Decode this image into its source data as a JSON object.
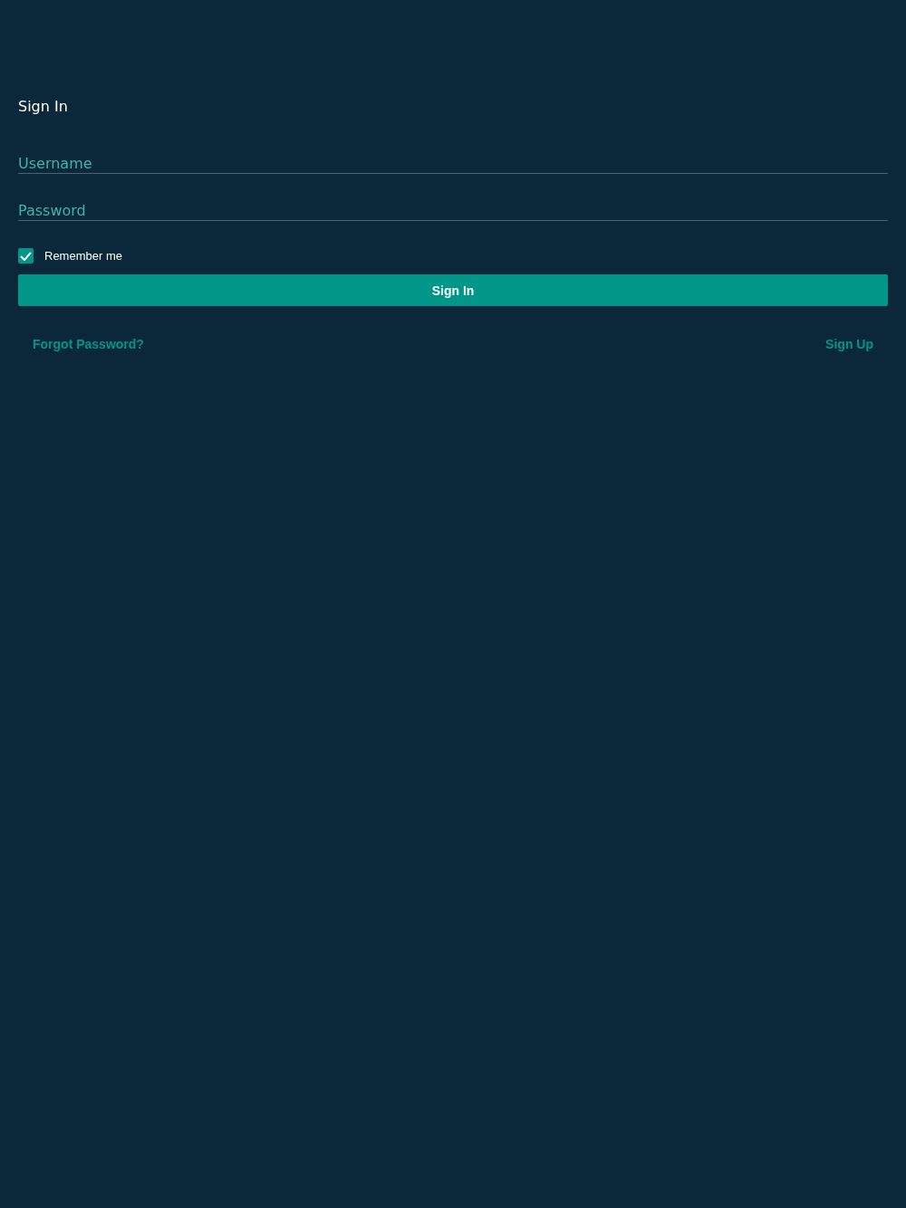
{
  "title": "Sign In",
  "fields": [
    {
      "placeholder": "Username"
    },
    {
      "placeholder": "Password"
    }
  ],
  "remember": {
    "label": "Remember me",
    "checked": true
  },
  "submit": {
    "label": "Sign In"
  },
  "links": [
    {
      "label": "Forgot Password?"
    },
    {
      "label": "Sign Up"
    }
  ]
}
